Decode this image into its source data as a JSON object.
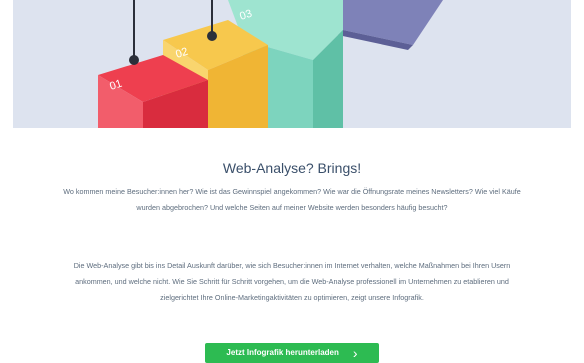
{
  "hero": {
    "step_labels": [
      "01",
      "02",
      "03"
    ],
    "colors": {
      "red": "#ee3f4f",
      "yellow": "#f7c84d",
      "mint": "#9ee4d0",
      "purple": "#7e82b8"
    }
  },
  "article": {
    "title": "Web-Analyse? Brings!",
    "paragraph1": "Wo kommen meine Besucher:innen her? Wie ist das Gewinnspiel angekommen? Wie war die Öffnungsrate meines Newsletters? Wie viel Käufe wurden abgebrochen? Und welche Seiten auf meiner Website werden besonders häufig besucht?",
    "paragraph2": "Die Web-Analyse gibt bis ins Detail Auskunft darüber, wie sich Besucher:innen im Internet verhalten, welche Maßnahmen bei Ihren Usern ankommen, und welche nicht. Wie Sie Schritt für Schritt vorgehen, um die Web-Analyse professionell im Unternehmen zu etablieren und zielgerichtet Ihre Online-Marketingaktivitäten zu optimieren, zeigt unsere Infografik.",
    "cta_label": "Jetzt Infografik herunterladen",
    "cta_icon": "chevron-right-icon",
    "cta_color": "#2dbb52"
  }
}
